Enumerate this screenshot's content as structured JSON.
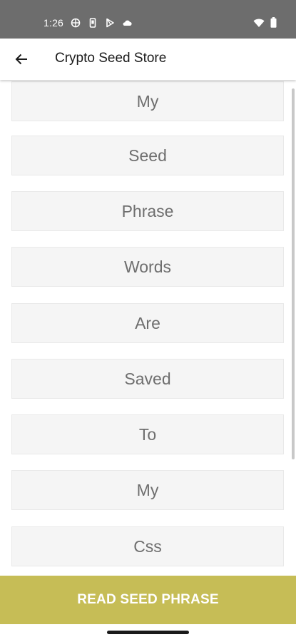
{
  "status_bar": {
    "time": "1:26",
    "icons_left": [
      "vpn-globe-icon",
      "device-icon",
      "play-store-icon",
      "cloud-icon"
    ],
    "icons_right": [
      "wifi-icon",
      "battery-icon"
    ]
  },
  "app_bar": {
    "title": "Crypto Seed Store",
    "back_icon": "arrow-back-icon"
  },
  "words": [
    "My",
    "Seed",
    "Phrase",
    "Words",
    "Are",
    "Saved",
    "To",
    "My",
    "Css"
  ],
  "bottom_button": {
    "label": "READ SEED PHRASE"
  },
  "colors": {
    "status_bar_bg": "#6d6d6d",
    "button_bg": "#c6bd56",
    "word_box_bg": "#f5f5f5",
    "word_text": "#6e6e6e"
  }
}
